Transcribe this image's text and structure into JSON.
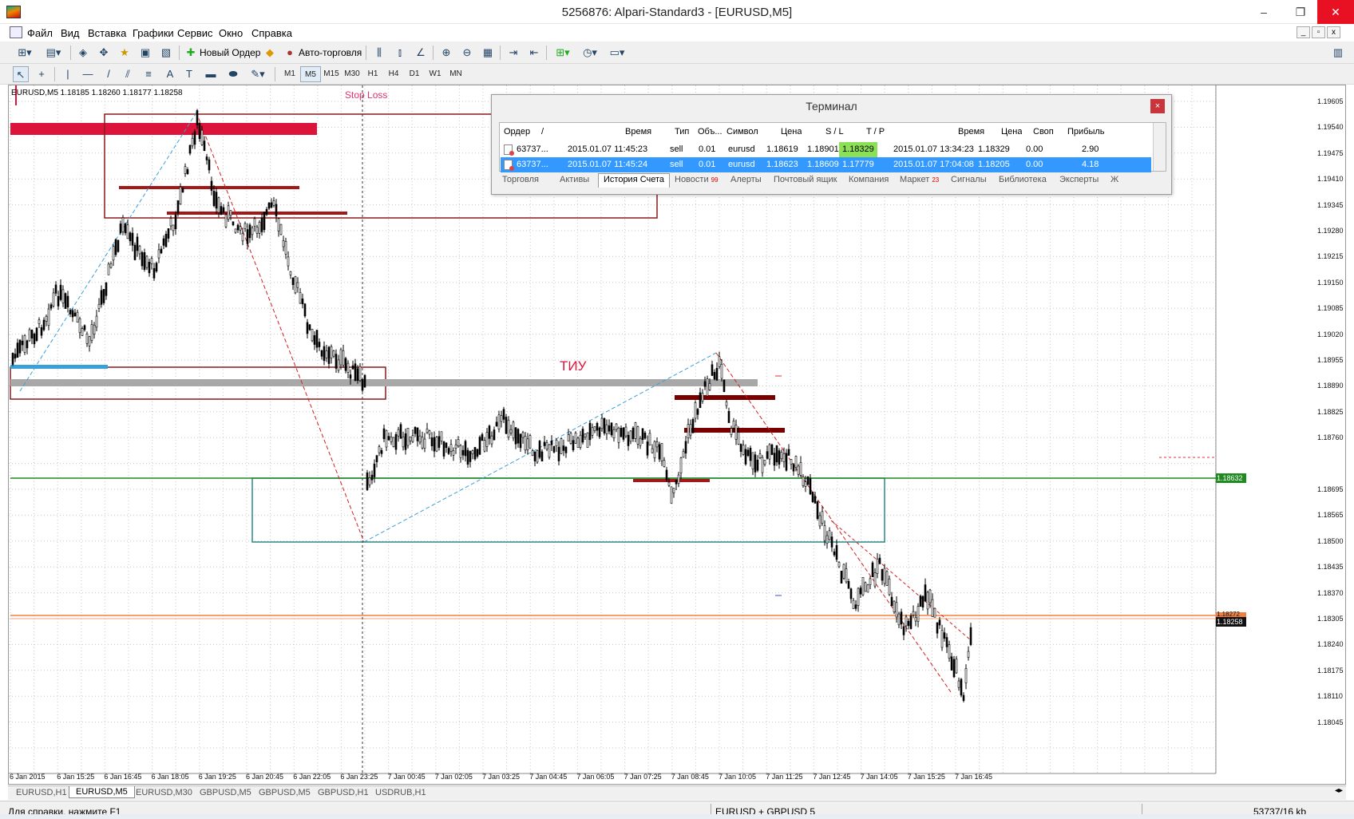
{
  "window": {
    "title": "5256876: Alpari-Standard3 - [EURUSD,M5]",
    "min": "‒",
    "max": "❐",
    "close": "✕"
  },
  "menu": [
    "Файл",
    "Вид",
    "Вставка",
    "Графики",
    "Сервис",
    "Окно",
    "Справка"
  ],
  "toolbar": {
    "new_order": "Новый Ордер",
    "auto_trading": "Авто-торговля"
  },
  "timeframes": [
    "M1",
    "M5",
    "M15",
    "M30",
    "H1",
    "H4",
    "D1",
    "W1",
    "MN"
  ],
  "active_timeframe": "M5",
  "symbol_info": "EURUSD,M5  1.18185 1.18260 1.18177 1.18258",
  "annotations": {
    "stop_loss": "Stop Loss",
    "tiu": "ТИУ"
  },
  "terminal": {
    "title": "Терминал",
    "close": "×",
    "columns": [
      "Ордер",
      "Время",
      "Тип",
      "Объ...",
      "Символ",
      "Цена",
      "S / L",
      "T / P",
      "Время",
      "Цена",
      "Своп",
      "Прибыль"
    ],
    "sort_marker": "/",
    "rows": [
      [
        "63737...",
        "2015.01.07 11:45:23",
        "sell",
        "0.01",
        "eurusd",
        "1.18619",
        "1.18901",
        "1.18329",
        "2015.01.07 13:34:23",
        "1.18329",
        "0.00",
        "2.90"
      ],
      [
        "63737...",
        "2015.01.07 11:45:24",
        "sell",
        "0.01",
        "eurusd",
        "1.18623",
        "1.18609",
        "1.17779",
        "2015.01.07 17:04:08",
        "1.18205",
        "0.00",
        "4.18"
      ]
    ],
    "tabs": [
      "Торговля",
      "Активы",
      "История Счета",
      "Новости",
      "Алерты",
      "Почтовый ящик",
      "Компания",
      "Маркет",
      "Сигналы",
      "Библиотека",
      "Эксперты",
      "Ж"
    ],
    "active_tab": "История Счета",
    "news_count": "99",
    "market_count": "23"
  },
  "price_axis": [
    "1.19605",
    "1.19540",
    "1.19475",
    "1.19410",
    "1.19345",
    "1.19280",
    "1.19215",
    "1.19150",
    "1.19085",
    "1.19020",
    "1.18955",
    "1.18890",
    "1.18825",
    "1.18760",
    "1.18695",
    "1.18565",
    "1.18500",
    "1.18435",
    "1.18370",
    "1.18305",
    "1.18240",
    "1.18175",
    "1.18110",
    "1.18045"
  ],
  "price_markers": {
    "green": "1.18632",
    "current": "1.18258",
    "orange": "1.18272"
  },
  "time_axis": [
    "6 Jan 2015",
    "6 Jan 15:25",
    "6 Jan 16:45",
    "6 Jan 18:05",
    "6 Jan 19:25",
    "6 Jan 20:45",
    "6 Jan 22:05",
    "6 Jan 23:25",
    "7 Jan 00:45",
    "7 Jan 02:05",
    "7 Jan 03:25",
    "7 Jan 04:45",
    "7 Jan 06:05",
    "7 Jan 07:25",
    "7 Jan 08:45",
    "7 Jan 10:05",
    "7 Jan 11:25",
    "7 Jan 12:45",
    "7 Jan 14:05",
    "7 Jan 15:25",
    "7 Jan 16:45"
  ],
  "chart_tabs": [
    "EURUSD,H1",
    "EURUSD,M5",
    "EURUSD,M30",
    "GBPUSD,M5",
    "GBPUSD,M5",
    "GBPUSD,H1",
    "USDRUB,H1"
  ],
  "active_chart_tab": "EURUSD,M5",
  "status": {
    "help": "Для справки, нажмите F1",
    "profile": "EURUSD + GBPUSD 5",
    "traffic": "53737/16 kb"
  },
  "colors": {
    "sell_zone": "#dc143c",
    "box_red": "#8b1a1a",
    "box_teal": "#2a8a8a",
    "green_line": "#1f8a1f",
    "orange_line": "#f08040",
    "blue_zone": "#3aa0d8",
    "gray_zone": "#a8a8a8"
  }
}
